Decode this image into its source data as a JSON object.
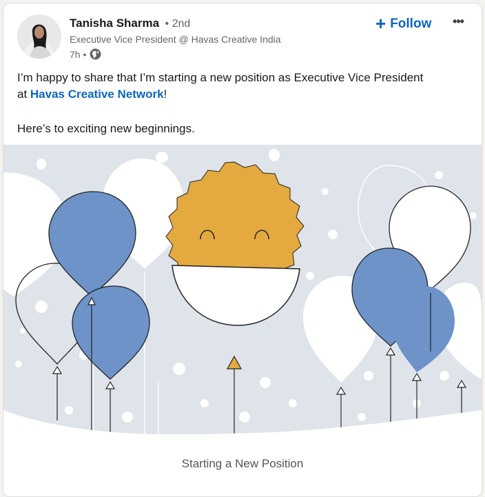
{
  "author": {
    "name": "Tanisha Sharma",
    "degree": "• 2nd",
    "headline": "Executive Vice President @ Havas Creative India",
    "time": "7h •",
    "visibility_icon": "globe-icon"
  },
  "actions": {
    "follow_label": "Follow",
    "follow_icon": "plus-icon",
    "more_label": "•••"
  },
  "post": {
    "line1": "I’m happy to share that I’m starting a new position as Executive Vice President",
    "line2_prefix": "at ",
    "company_link": "Havas Creative Network",
    "line2_suffix": "!",
    "line3": "Here’s to exciting new beginnings."
  },
  "media": {
    "caption": "Starting a New Position",
    "colors": {
      "background": "#dfe3ea",
      "blue_balloon": "#6d93c9",
      "smiley": "#e4a93f",
      "link": "#0a66c2"
    }
  }
}
